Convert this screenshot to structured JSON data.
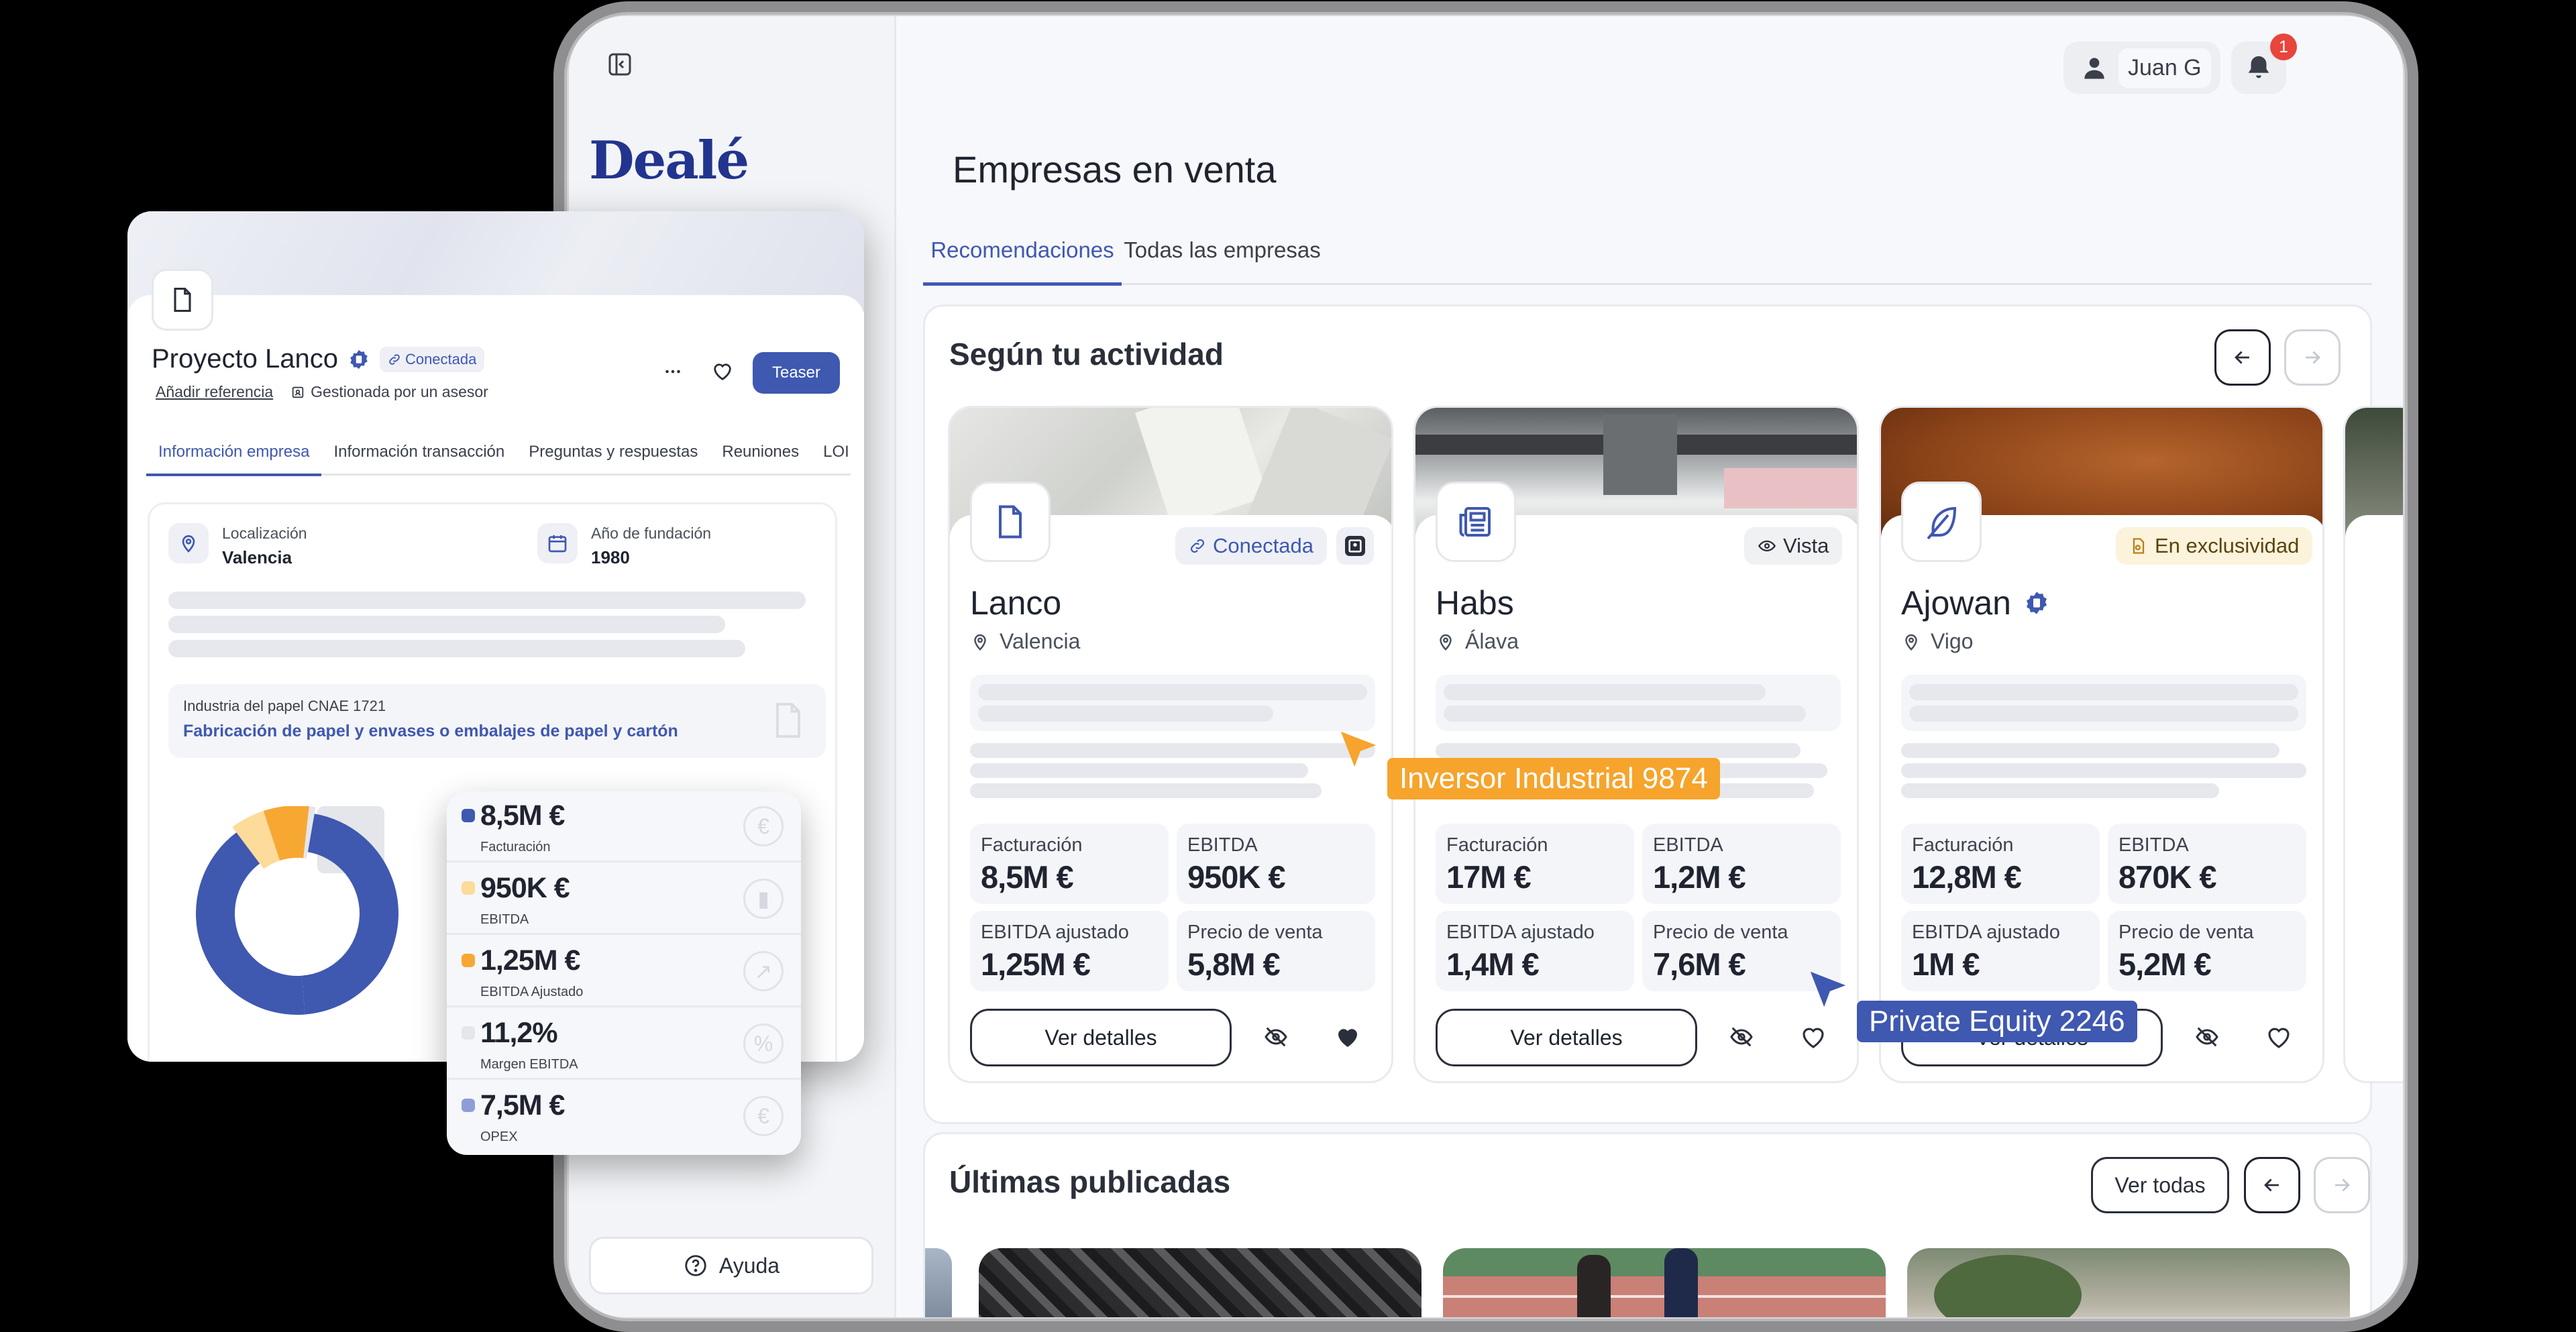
{
  "header": {
    "user_name": "Juan G",
    "notification_count": "1"
  },
  "sidebar": {
    "logo": "Dealé",
    "help_label": "Ayuda"
  },
  "page": {
    "title": "Empresas en venta"
  },
  "tabs": [
    {
      "label": "Recomendaciones"
    },
    {
      "label": "Todas las empresas"
    }
  ],
  "section_activity": {
    "title": "Según tu actividad"
  },
  "cards": [
    {
      "name": "Lanco",
      "location": "Valencia",
      "badge": "Conectada",
      "m1_label": "Facturación",
      "m1_value": "8,5M €",
      "m2_label": "EBITDA",
      "m2_value": "950K €",
      "m3_label": "EBITDA ajustado",
      "m3_value": "1,25M €",
      "m4_label": "Precio de venta",
      "m4_value": "5,8M €",
      "details_label": "Ver detalles"
    },
    {
      "name": "Habs",
      "location": "Álava",
      "badge": "Vista",
      "m1_label": "Facturación",
      "m1_value": "17M €",
      "m2_label": "EBITDA",
      "m2_value": "1,2M €",
      "m3_label": "EBITDA ajustado",
      "m3_value": "1,4M €",
      "m4_label": "Precio de venta",
      "m4_value": "7,6M €",
      "details_label": "Ver detalles"
    },
    {
      "name": "Ajowan",
      "location": "Vigo",
      "badge": "En exclusividad",
      "m1_label": "Facturación",
      "m1_value": "12,8M €",
      "m2_label": "EBITDA",
      "m2_value": "870K €",
      "m3_label": "EBITDA ajustado",
      "m3_value": "1M €",
      "m4_label": "Precio de venta",
      "m4_value": "5,2M €",
      "details_label": "Ver detalles"
    }
  ],
  "section_latest": {
    "title": "Últimas publicadas",
    "see_all_label": "Ver todas"
  },
  "cursors": [
    {
      "label": "Inversor Industrial 9874",
      "color": "#f6a42c"
    },
    {
      "label": "Private Equity 2246",
      "color": "#3f58b0"
    }
  ],
  "project": {
    "title": "Proyecto Lanco",
    "badge": "Conectada",
    "add_reference": "Añadir referencia",
    "managed_by": "Gestionada por un asesor",
    "teaser_label": "Teaser",
    "tabs": [
      {
        "label": "Información empresa"
      },
      {
        "label": "Información transacción"
      },
      {
        "label": "Preguntas y respuestas"
      },
      {
        "label": "Reuniones"
      },
      {
        "label": "LOI"
      }
    ],
    "location_label": "Localización",
    "location_value": "Valencia",
    "founded_label": "Año de fundación",
    "founded_value": "1980",
    "industry_label": "Industria del papel CNAE 1721",
    "industry_value": "Fabricación de papel y envases o embalajes de papel y cartón"
  },
  "financials": [
    {
      "value": "8,5M €",
      "label": "Facturación",
      "color": "#3f58b0",
      "icon": "euro-icon"
    },
    {
      "value": "950K €",
      "label": "EBITDA",
      "color": "#fddb9a",
      "icon": "bar-chart-icon"
    },
    {
      "value": "1,25M €",
      "label": "EBITDA Ajustado",
      "color": "#f7a833",
      "icon": "line-chart-icon"
    },
    {
      "value": "11,2%",
      "label": "Margen EBITDA",
      "color": "#e4e6ea",
      "icon": "percent-icon"
    },
    {
      "value": "7,5M €",
      "label": "OPEX",
      "color": "#8e9ed9",
      "icon": "euro-square-icon"
    }
  ],
  "chart_data": {
    "type": "pie",
    "values": [
      8.5,
      0.95,
      1.25,
      0.112,
      7.5
    ],
    "categories": [
      "Facturación",
      "EBITDA",
      "EBITDA Ajustado",
      "Margen EBITDA",
      "OPEX"
    ]
  }
}
